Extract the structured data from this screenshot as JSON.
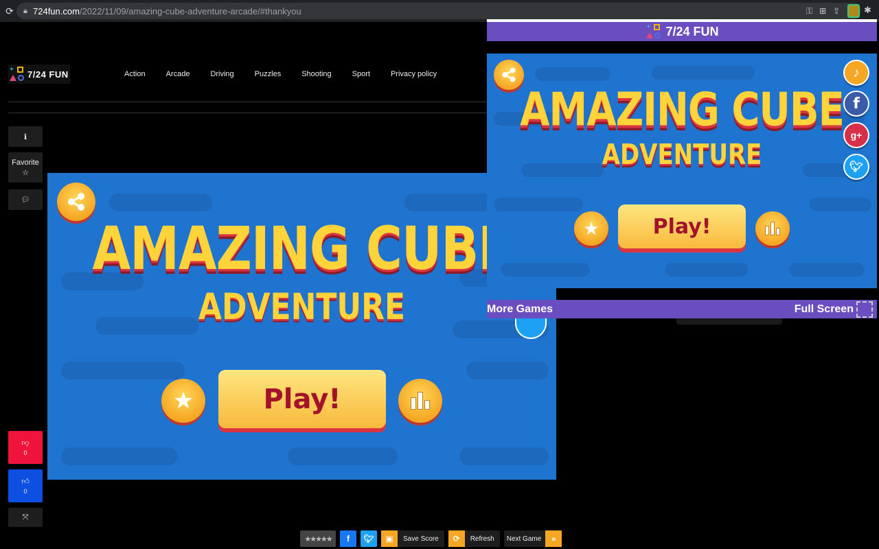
{
  "browser": {
    "url_host": "724fun.com",
    "url_path": "/2022/11/09/amazing-cube-adventure-arcade/#thankyou"
  },
  "site": {
    "logo_text": "7/24 FUN",
    "nav": [
      "Action",
      "Arcade",
      "Driving",
      "Puzzles",
      "Shooting",
      "Sport",
      "Privacy policy"
    ]
  },
  "side": {
    "favorite_label": "Favorite",
    "dislike_count": "0",
    "like_count": "0"
  },
  "game": {
    "title": "AMAZING CUBE",
    "subtitle": "ADVENTURE",
    "play_label": "Play!"
  },
  "popup": {
    "header_text": "7/24 FUN",
    "more_games": "More Games",
    "full_screen": "Full Screen"
  },
  "toolbar": {
    "save_score": "Save Score",
    "refresh": "Refresh",
    "next_game": "Next Game"
  },
  "colors": {
    "purple": "#6a4ec0",
    "game_blue": "#1f74cf",
    "dislike_red": "#f0143c",
    "like_blue": "#0d4fe0",
    "toolbar_orange": "#f5a623"
  }
}
